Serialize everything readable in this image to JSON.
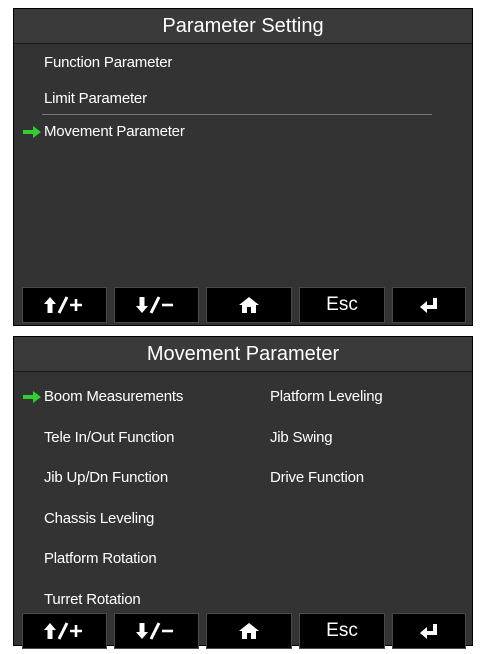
{
  "screen1": {
    "title": "Parameter Setting",
    "items": [
      {
        "label": "Function Parameter",
        "selected": false
      },
      {
        "label": "Limit Parameter",
        "selected": false
      },
      {
        "label": "Movement Parameter",
        "selected": true
      }
    ]
  },
  "screen2": {
    "title": "Movement Parameter",
    "left_items": [
      {
        "label": "Boom Measurements",
        "selected": true
      },
      {
        "label": "Tele In/Out Function",
        "selected": false
      },
      {
        "label": "Jib Up/Dn Function",
        "selected": false
      },
      {
        "label": "Chassis Leveling",
        "selected": false
      },
      {
        "label": "Platform Rotation",
        "selected": false
      },
      {
        "label": "Turret Rotation",
        "selected": false
      }
    ],
    "right_items": [
      {
        "label": "Platform Leveling",
        "selected": false
      },
      {
        "label": "Jib Swing",
        "selected": false
      },
      {
        "label": "Drive Function",
        "selected": false
      }
    ]
  },
  "buttons": {
    "up_icon": "up-arrow-plus-icon",
    "down_icon": "down-arrow-minus-icon",
    "home_icon": "home-icon",
    "esc_label": "Esc",
    "enter_icon": "enter-return-icon"
  },
  "colors": {
    "screen_bg": "#333333",
    "button_bg": "#000000",
    "selection_arrow": "#33cc33",
    "text": "#ffffff"
  }
}
